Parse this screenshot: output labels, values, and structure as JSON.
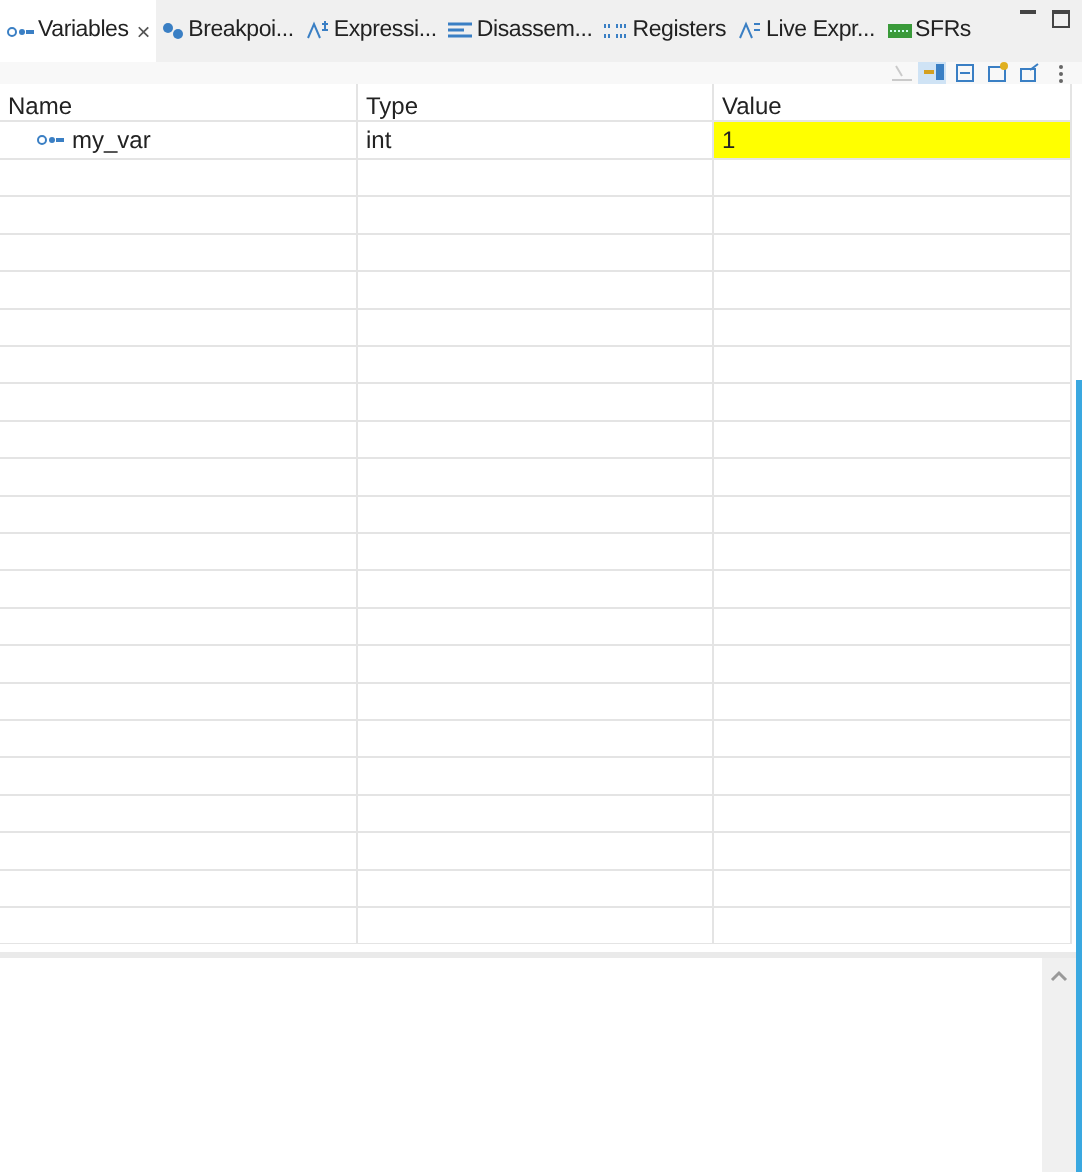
{
  "tabs": [
    {
      "label": "Variables",
      "selected": true,
      "close": "×"
    },
    {
      "label": "Breakpoi...",
      "selected": false
    },
    {
      "label": "Expressi...",
      "selected": false
    },
    {
      "label": "Disassem...",
      "selected": false
    },
    {
      "label": "Registers",
      "selected": false
    },
    {
      "label": "Live Expr...",
      "selected": false
    },
    {
      "label": "SFRs",
      "selected": false
    }
  ],
  "toolbar": [
    {
      "pressed": false,
      "disabled": true
    },
    {
      "pressed": true,
      "disabled": false
    },
    {
      "pressed": false,
      "disabled": false
    },
    {
      "pressed": false,
      "disabled": false
    },
    {
      "pressed": false,
      "disabled": false
    }
  ],
  "table": {
    "columns": [
      "Name",
      "Type",
      "Value"
    ],
    "rows": [
      {
        "name": "my_var",
        "type": "int",
        "value": "1",
        "changed": true
      }
    ]
  }
}
